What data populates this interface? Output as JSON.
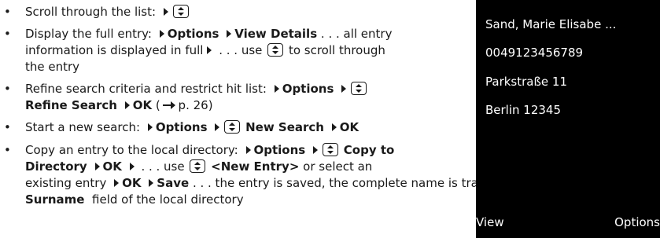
{
  "instructions": {
    "items": [
      {
        "text1": "Scroll through the list:"
      },
      {
        "text1": "Display the full entry:",
        "opt": "Options",
        "view_details": "View Details",
        "rest": ". . . all entry",
        "line2a": "information is displayed in full",
        "line2b": ". . . use",
        "line2c": "to scroll through",
        "line3": "the entry"
      },
      {
        "text1": "Refine search criteria and restrict hit list:",
        "opt": "Options",
        "refine": "Refine Search",
        "ok": "OK",
        "ref": "p. 26)"
      },
      {
        "text1": "Start a new search:",
        "opt": "Options",
        "new_search": "New Search",
        "ok": "OK"
      },
      {
        "text1": "Copy an entry to the local directory:",
        "opt": "Options",
        "copy_to": "Copy to",
        "directory": "Directory",
        "ok": "OK",
        "use": ". . . use",
        "new_entry": "<New Entry>",
        "select": "or select an",
        "line3a": "existing entry",
        "ok2": "OK",
        "save": "Save",
        "line3b": ". . . the entry is saved, the complete name is transferred to the",
        "surname": "Surname",
        "line4": "field of the local directory"
      }
    ]
  },
  "phone": {
    "entries": [
      "Sand, Marie Elisabe ...",
      "0049123456789",
      "Parkstraße 11",
      "Berlin 12345"
    ],
    "softkeys": {
      "left": "View",
      "right": "Options"
    }
  }
}
